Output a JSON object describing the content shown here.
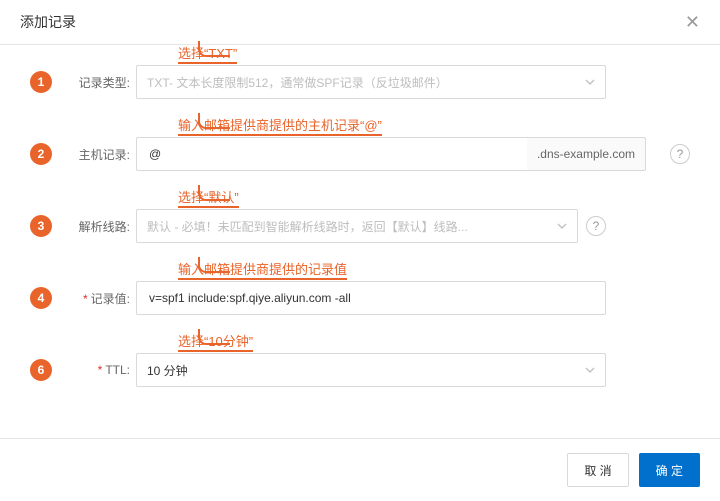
{
  "header": {
    "title": "添加记录"
  },
  "rows": [
    {
      "num": "1",
      "label": "记录类型",
      "hint": "选择“TXT”",
      "value": "TXT- 文本长度限制512，通常做SPF记录（反垃圾邮件）"
    },
    {
      "num": "2",
      "label": "主机记录",
      "hint": "输入邮箱提供商提供的主机记录“@”",
      "value": "@",
      "suffix": ".dns-example.com"
    },
    {
      "num": "3",
      "label": "解析线路",
      "hint": "选择“默认”",
      "value": "默认 - 必填！未匹配到智能解析线路时，返回【默认】线路..."
    },
    {
      "num": "4",
      "label": "记录值",
      "hint": "输入邮箱提供商提供的记录值",
      "value": "v=spf1 include:spf.qiye.aliyun.com -all"
    },
    {
      "num": "6",
      "label": "TTL",
      "hint": "选择“10分钟”",
      "value": "10 分钟"
    }
  ],
  "footer": {
    "cancel": "取 消",
    "confirm": "确 定"
  }
}
